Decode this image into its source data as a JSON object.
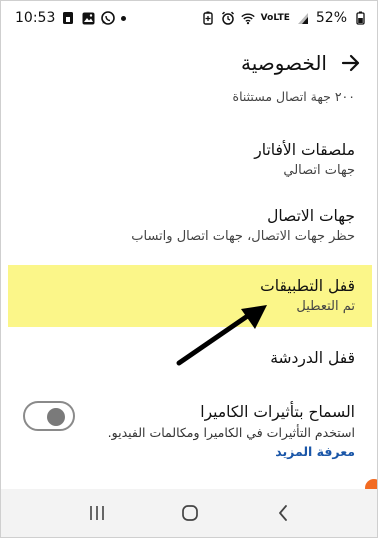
{
  "status_bar": {
    "time": "10:53",
    "battery_percent": "52%",
    "network_label": "VoLTE",
    "icons": [
      "sim-icon",
      "gallery-icon",
      "whatsapp-icon",
      "notification-dot-icon",
      "battery-saver-icon",
      "alarm-icon",
      "wifi-icon",
      "signal-icon",
      "battery-icon"
    ]
  },
  "header": {
    "title": "الخصوصية",
    "back_icon": "arrow-right-icon"
  },
  "items": {
    "partial": {
      "subtitle": "٢٠٠ جهة اتصال مستثناة"
    },
    "avatar_stickers": {
      "title": "ملصقات الأفاتار",
      "subtitle": "جهات اتصالي"
    },
    "contacts": {
      "title": "جهات الاتصال",
      "subtitle": "حظر جهات الاتصال، جهات اتصال واتساب"
    },
    "app_lock": {
      "title": "قفل التطبيقات",
      "subtitle": "تم التعطيل",
      "highlight_color": "#fbf689"
    },
    "chat_lock": {
      "title": "قفل الدردشة"
    },
    "camera_effects": {
      "title": "السماح بتأثيرات الكاميرا",
      "subtitle": "استخدم التأثيرات في الكاميرا ومكالمات الفيديو.",
      "learn_more": "معرفة المزيد",
      "toggle_on": false
    }
  },
  "annotation": {
    "arrow_icon": "annotation-arrow-icon"
  },
  "nav_bar": {
    "recent_icon": "recents-icon",
    "home_icon": "home-icon",
    "back_icon": "back-chevron-icon"
  },
  "colors": {
    "link": "#1a56a8",
    "highlight": "#fbf689",
    "badge": "#f26b22"
  }
}
